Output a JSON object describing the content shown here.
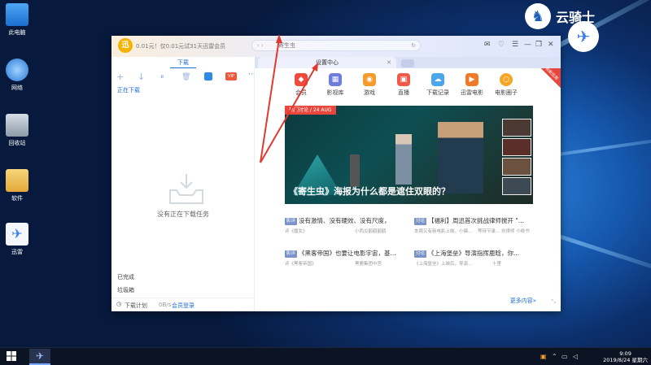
{
  "desktop": {
    "icons": [
      {
        "label": "此电脑"
      },
      {
        "label": "网络"
      },
      {
        "label": "回收站"
      },
      {
        "label": "软件"
      },
      {
        "label": "迅雷"
      }
    ],
    "watermark": "云骑士"
  },
  "app": {
    "promo_text": "0.01元！仅0.01元试31天迅雷会员",
    "logo_glyph": "迅",
    "search_value": "寄生虫",
    "tabs": {
      "download": "下载",
      "settings": "设置中心"
    },
    "window_controls": [
      "✉",
      "♡",
      "☰",
      "—",
      "❐",
      "✕"
    ],
    "left_panel": {
      "tools": [
        "+",
        "↓",
        "⏸",
        "🗑"
      ],
      "downloading_label": "正在下载",
      "empty_text": "没有正在下载任务",
      "completed_label": "已完成",
      "trash_label": "垃圾箱",
      "schedule_label": "下载计划",
      "speed_text": "0B/s",
      "login_label": "会员登录"
    },
    "categories": [
      {
        "label": "会员",
        "color": "#f04a3a"
      },
      {
        "label": "影视库",
        "color": "#6e7ddc"
      },
      {
        "label": "游戏",
        "color": "#f59a2b"
      },
      {
        "label": "直播",
        "color": "#ef5a4a"
      },
      {
        "label": "下载记录",
        "color": "#4aa8ea"
      },
      {
        "label": "迅雷电影",
        "color": "#f07a2a"
      },
      {
        "label": "电影圈子",
        "color": "#f5a623"
      }
    ],
    "corner_tag": "有新应用",
    "hero": {
      "tag": "热门讨论 / 24 AUG",
      "title": "《寄生虫》海报为什么都是遮住双眼的？"
    },
    "news": [
      {
        "tag": "影评",
        "title": "没有激情、没有硬效、没有尺度，",
        "source": "评《魔女》",
        "author": "小西瓜鹤鹤鹤鹤"
      },
      {
        "tag": "讨论",
        "title": "【福利】周迅首次挑战律师搅开 \"...",
        "source": "本周又有新电影上映，小编...",
        "author": "等待节录... 刘律师 小桃书"
      },
      {
        "tag": "影评",
        "title": "《黑客帝国》也要让电影宇宙，基...",
        "source": "评《黑客帝国》",
        "author": "黑鹿集团中宫"
      },
      {
        "tag": "讨论",
        "title": "《上海堡垒》导演指挥鹿晗，你...",
        "source": "《上海堡垒》上映后，导演...",
        "author": "十里"
      }
    ],
    "more_label": "更多内容»"
  },
  "taskbar": {
    "time": "9:09",
    "date": "2019/8/24 星期六",
    "app_glyph": "✈"
  }
}
